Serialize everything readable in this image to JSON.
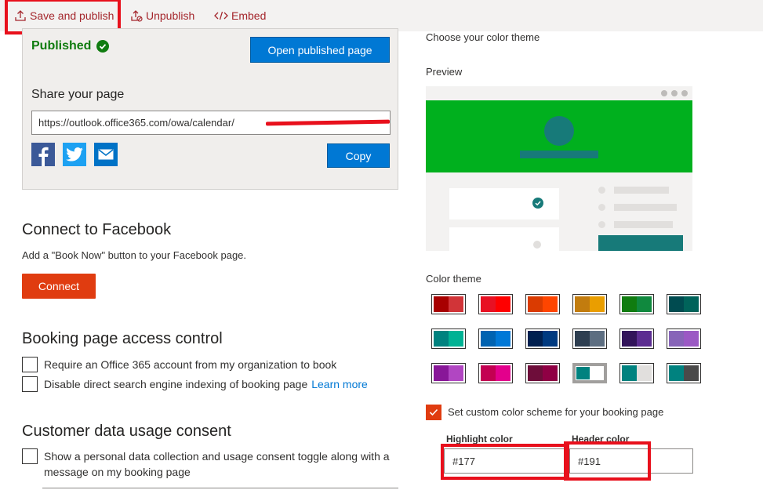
{
  "toolbar": {
    "save_publish": "Save and publish",
    "unpublish": "Unpublish",
    "embed": "Embed"
  },
  "publish_panel": {
    "status": "Published",
    "open_button": "Open published page",
    "share_title": "Share your page",
    "url": "https://outlook.office365.com/owa/calendar/",
    "copy_button": "Copy",
    "social_icons": [
      "facebook-icon",
      "twitter-icon",
      "mail-icon"
    ]
  },
  "facebook": {
    "title": "Connect to Facebook",
    "description": "Add a \"Book Now\" button to your Facebook page.",
    "connect_button": "Connect"
  },
  "access_control": {
    "title": "Booking page access control",
    "options": [
      {
        "label": "Require an Office 365 account from my organization to book",
        "checked": false
      },
      {
        "label": "Disable direct search engine indexing of booking page",
        "checked": false
      }
    ],
    "learn_more": "Learn more"
  },
  "consent": {
    "title": "Customer data usage consent",
    "option_line1": "Show a personal data collection and usage consent toggle along with a",
    "option_line2": "message on my booking page",
    "checked": false
  },
  "theme": {
    "title": "Choose your color theme",
    "preview_label": "Preview",
    "color_theme_label": "Color theme",
    "preview_colors": {
      "header": "#00b01e",
      "accent": "#177a79"
    },
    "swatches": [
      [
        "#a80000",
        "#d13438"
      ],
      [
        "#e81123",
        "#ff0000"
      ],
      [
        "#da3b01",
        "#ff4500"
      ],
      [
        "#c27c0e",
        "#ea9e00"
      ],
      [
        "#107c10",
        "#10893e"
      ],
      [
        "#004b50",
        "#00635a"
      ],
      [
        "#00827f",
        "#00b294"
      ],
      [
        "#0063b1",
        "#0078d7"
      ],
      [
        "#002050",
        "#003a80"
      ],
      [
        "#2d3e50",
        "#5d6e81"
      ],
      [
        "#32145a",
        "#5c2d91"
      ],
      [
        "#8764b8",
        "#9b59c4"
      ],
      [
        "#881798",
        "#b146c2"
      ],
      [
        "#c30052",
        "#e3008c"
      ],
      [
        "#6e0d3a",
        "#8f0044"
      ],
      [
        "#00827f",
        "#ffffff"
      ],
      [
        "#00827f",
        "#e1dfdd"
      ],
      [
        "#00827f",
        "#4a4a4a"
      ]
    ],
    "selected_swatch": 15,
    "custom_scheme_label": "Set custom color scheme for your booking page",
    "custom_scheme_checked": true,
    "highlight_label": "Highlight color",
    "highlight_value": "#177",
    "header_label": "Header color",
    "header_value": "#191"
  }
}
